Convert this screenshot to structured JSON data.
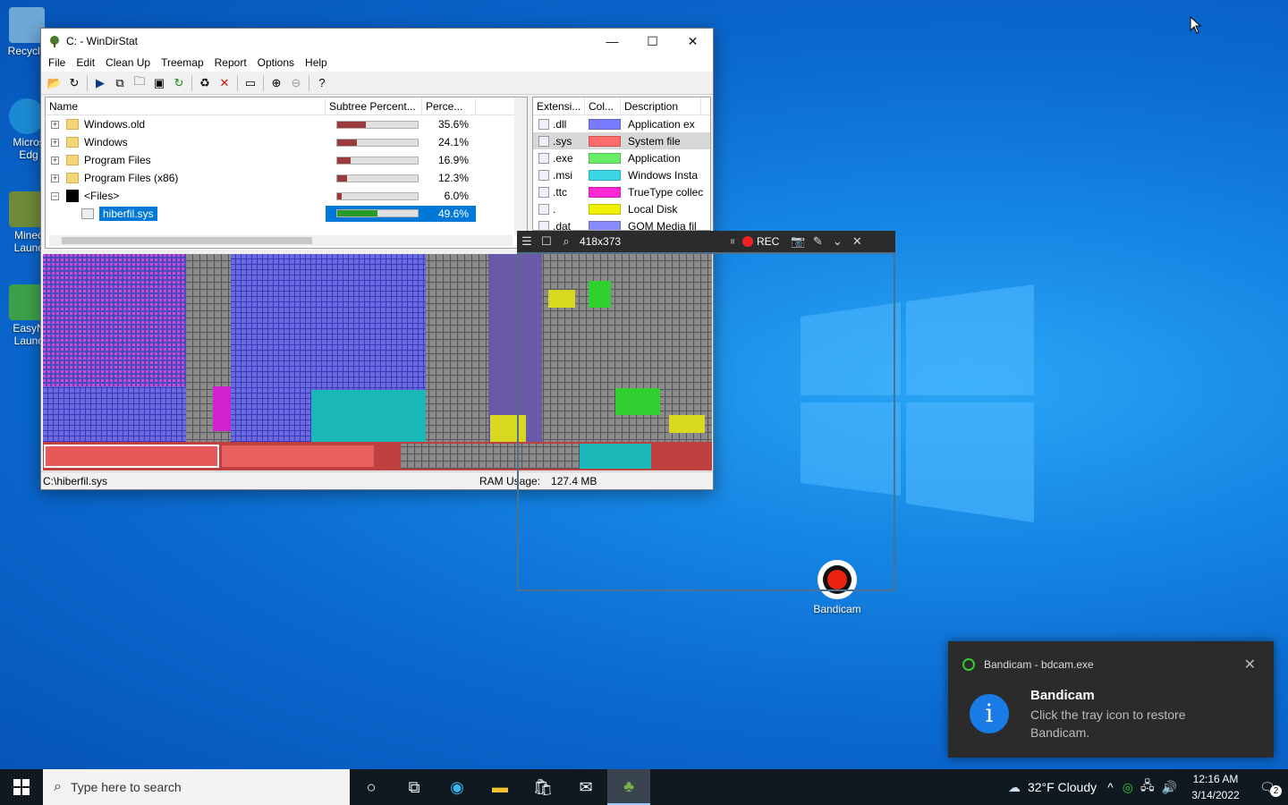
{
  "desktop": {
    "icons": [
      {
        "label": "Recycle",
        "color": "#6ea8d8"
      },
      {
        "label": "Micros Edg",
        "color": "#1c8ad2"
      },
      {
        "label": "Minec Launc",
        "color": "#6f8a3a"
      },
      {
        "label": "EasyN Launc",
        "color": "#3ca04a"
      }
    ],
    "bandicam_icon_label": "Bandicam"
  },
  "window": {
    "title": "C: - WinDirStat",
    "controls": {
      "minimize": "—",
      "maximize": "☐",
      "close": "✕"
    },
    "menu": [
      "File",
      "Edit",
      "Clean Up",
      "Treemap",
      "Report",
      "Options",
      "Help"
    ]
  },
  "tree": {
    "columns": [
      "Name",
      "Subtree Percent...",
      "Perce..."
    ],
    "rows": [
      {
        "name": "Windows.old",
        "percent": "35.6%",
        "fill": 0.356
      },
      {
        "name": "Windows",
        "percent": "24.1%",
        "fill": 0.241
      },
      {
        "name": "Program Files",
        "percent": "16.9%",
        "fill": 0.169
      },
      {
        "name": "Program Files (x86)",
        "percent": "12.3%",
        "fill": 0.123
      },
      {
        "name": "<Files>",
        "percent": "6.0%",
        "fill": 0.06
      },
      {
        "name": "hiberfil.sys",
        "percent": "49.6%",
        "fill": 0.496
      }
    ]
  },
  "extensions": {
    "columns": [
      "Extensi...",
      "Col...",
      "Description"
    ],
    "rows": [
      {
        "ext": ".dll",
        "color": "#7a7aff",
        "desc": "Application ex"
      },
      {
        "ext": ".sys",
        "color": "#ff6a6a",
        "desc": "System file"
      },
      {
        "ext": ".exe",
        "color": "#6aee6a",
        "desc": "Application"
      },
      {
        "ext": ".msi",
        "color": "#3ad6e6",
        "desc": "Windows Insta"
      },
      {
        "ext": ".ttc",
        "color": "#ff2ad6",
        "desc": "TrueType collec"
      },
      {
        "ext": ".",
        "color": "#f0f000",
        "desc": "Local Disk"
      },
      {
        "ext": ".dat",
        "color": "#8a8aff",
        "desc": "GOM Media fil"
      }
    ]
  },
  "status": {
    "path": "C:\\hiberfil.sys",
    "ram_label": "RAM Usage:",
    "ram_value": "127.4 MB"
  },
  "bandicam_bar": {
    "size": "418x373",
    "rec": "REC"
  },
  "toast": {
    "app": "Bandicam - bdcam.exe",
    "title": "Bandicam",
    "body": "Click the tray icon to restore Bandicam."
  },
  "taskbar": {
    "search_placeholder": "Type here to search",
    "weather": "32°F  Cloudy",
    "time": "12:16 AM",
    "date": "3/14/2022",
    "notif_count": "2"
  }
}
